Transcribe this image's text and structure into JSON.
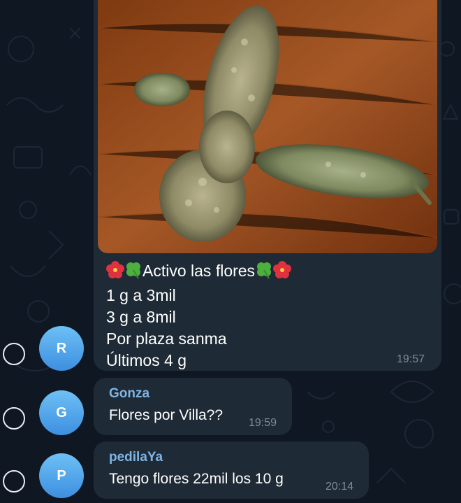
{
  "messages": [
    {
      "avatar_letter": "R",
      "caption_lines": [
        "Activo las flores",
        "1 g a 3mil",
        "3 g a 8mil",
        "Por plaza sanma",
        "Últimos 4 g"
      ],
      "time": "19:57"
    },
    {
      "avatar_letter": "G",
      "sender": "Gonza",
      "text": "Flores por Villa??",
      "time": "19:59"
    },
    {
      "avatar_letter": "P",
      "sender": "pedilaYa",
      "text": "Tengo flores 22mil los 10 g",
      "time": "20:14"
    }
  ],
  "colors": {
    "background": "#0f1722",
    "bubble": "#1e2a35",
    "sender_name": "#7fb4e3",
    "avatar_gradient_top": "#6ec0f5",
    "avatar_gradient_bottom": "#3d8fe0"
  },
  "icons": [
    "hibiscus-emoji",
    "four-leaf-clover-emoji",
    "select-circle"
  ]
}
